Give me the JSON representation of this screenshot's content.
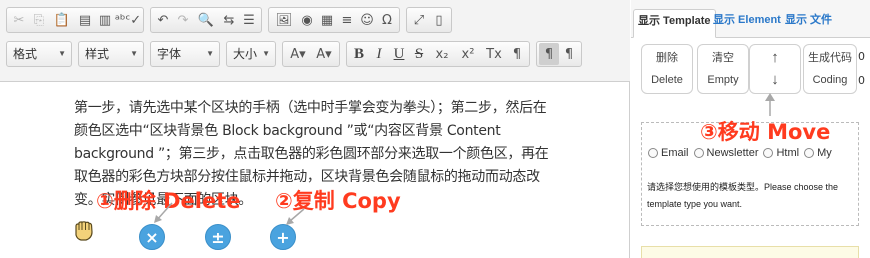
{
  "toolbar": {
    "row1_groups": [
      [
        {
          "name": "cut-icon",
          "glyph": "✂",
          "disabled": true
        },
        {
          "name": "copy-icon",
          "glyph": "⎘",
          "disabled": true
        },
        {
          "name": "paste-icon",
          "glyph": "📋",
          "disabled": false
        },
        {
          "name": "paste-text-icon",
          "glyph": "▤",
          "disabled": false
        },
        {
          "name": "paste-word-icon",
          "glyph": "▥",
          "disabled": false
        },
        {
          "name": "spellcheck-icon",
          "glyph": "ᵃᵇᶜ✓",
          "disabled": false
        }
      ],
      [
        {
          "name": "undo-icon",
          "glyph": "↶",
          "disabled": false
        },
        {
          "name": "redo-icon",
          "glyph": "↷",
          "disabled": true
        },
        {
          "name": "find-icon",
          "glyph": "🔍",
          "disabled": false
        },
        {
          "name": "replace-icon",
          "glyph": "⇆",
          "disabled": false
        },
        {
          "name": "select-all-icon",
          "glyph": "☰",
          "disabled": false
        }
      ],
      [
        {
          "name": "image-icon",
          "glyph": "🖼",
          "disabled": false
        },
        {
          "name": "flash-icon",
          "glyph": "◉",
          "disabled": false
        },
        {
          "name": "table-icon",
          "glyph": "▦",
          "disabled": false
        },
        {
          "name": "horizontal-rule-icon",
          "glyph": "≡",
          "disabled": false
        },
        {
          "name": "smiley-icon",
          "glyph": "☺",
          "disabled": false
        },
        {
          "name": "special-char-icon",
          "glyph": "Ω",
          "disabled": false
        }
      ],
      [
        {
          "name": "maximize-icon",
          "glyph": "⤢",
          "disabled": false
        },
        {
          "name": "show-blocks-icon",
          "glyph": "▯",
          "disabled": false
        }
      ]
    ],
    "dropdowns": [
      {
        "name": "format-dropdown",
        "label": "格式",
        "width": 66
      },
      {
        "name": "style-dropdown",
        "label": "样式",
        "width": 66
      },
      {
        "name": "font-dropdown",
        "label": "字体",
        "width": 70
      },
      {
        "name": "size-dropdown",
        "label": "大小",
        "width": 50
      }
    ],
    "row2_groups": [
      [
        {
          "name": "text-color-icon",
          "glyph": "A▾",
          "disabled": false
        },
        {
          "name": "bg-color-icon",
          "glyph": "A▾",
          "disabled": false
        }
      ],
      [
        {
          "name": "bold-icon",
          "glyph": "B",
          "disabled": false
        },
        {
          "name": "italic-icon",
          "glyph": "I",
          "disabled": false
        },
        {
          "name": "underline-icon",
          "glyph": "U",
          "disabled": false
        },
        {
          "name": "strike-icon",
          "glyph": "S",
          "disabled": false
        },
        {
          "name": "subscript-icon",
          "glyph": "x₂",
          "disabled": false
        },
        {
          "name": "superscript-icon",
          "glyph": "x²",
          "disabled": false
        },
        {
          "name": "remove-format-icon",
          "glyph": "Tx",
          "disabled": false
        },
        {
          "name": "ltr-icon",
          "glyph": "¶",
          "disabled": false
        }
      ],
      [
        {
          "name": "bidi-ltr-icon",
          "glyph": "¶",
          "disabled": false,
          "active": true
        },
        {
          "name": "bidi-rtl-icon",
          "glyph": "¶",
          "disabled": false
        }
      ]
    ]
  },
  "content": {
    "paragraph": "第一步，请先选中某个区块的手柄（选中时手掌会变为拳头）；第二步，然后在颜色区选中“区块背景色 Block background ”或“内容区背景 Content background ”；第三步，点击取色器的彩色圆环部分来选取一个颜色区，再在取色器的彩色方块部分按住鼠标并拖动，区块背景色会随鼠标的拖动而动态改变。实例参见最下面的区块。",
    "annotation_delete": "①删除 Delete",
    "annotation_copy": "②复制 Copy",
    "annotation_move": "③移动 Move",
    "delete_glyph": "×",
    "copy_glyph": "±",
    "add_glyph": "+"
  },
  "panel": {
    "tabs": [
      {
        "label": "显示 Template",
        "active": true
      },
      {
        "label": "显示 Element",
        "active": false
      },
      {
        "label": "显示 文件",
        "active": false
      }
    ],
    "actions": [
      {
        "name": "delete-button",
        "top": "删除",
        "bottom": "Delete"
      },
      {
        "name": "clear-button",
        "top": "清空",
        "bottom": "Empty"
      },
      {
        "name": "move-button",
        "top": "↑",
        "bottom": "↓"
      },
      {
        "name": "generate-code-button",
        "top": "生成代码",
        "bottom": "Coding"
      }
    ],
    "zero_values": [
      "0",
      "0"
    ],
    "template_options": [
      "Email",
      "Newsletter",
      "Html",
      "My"
    ],
    "template_hint": "请选择您想使用的模板类型。Please choose the template type you want."
  },
  "colors": {
    "annotation": "#ff3b1f",
    "link_blue": "#2a78c9",
    "handle_blue": "#4aa3df"
  }
}
